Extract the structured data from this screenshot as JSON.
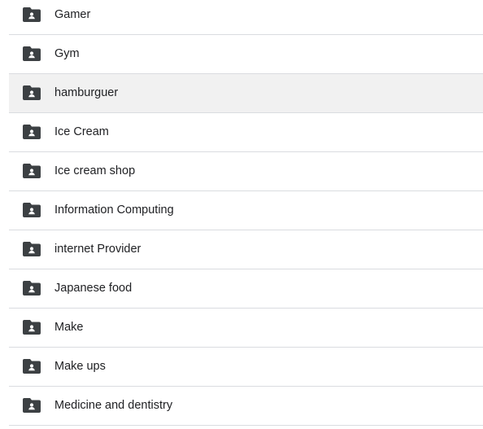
{
  "folders": [
    {
      "name": "Gamer",
      "icon": "shared-folder-icon",
      "selected": false
    },
    {
      "name": "Gym",
      "icon": "shared-folder-icon",
      "selected": false
    },
    {
      "name": "hamburguer",
      "icon": "shared-folder-icon",
      "selected": true
    },
    {
      "name": "Ice Cream",
      "icon": "shared-folder-icon",
      "selected": false
    },
    {
      "name": "Ice cream shop",
      "icon": "shared-folder-icon",
      "selected": false
    },
    {
      "name": "Information Computing",
      "icon": "shared-folder-icon",
      "selected": false
    },
    {
      "name": "internet Provider",
      "icon": "shared-folder-icon",
      "selected": false
    },
    {
      "name": "Japanese food",
      "icon": "shared-folder-icon",
      "selected": false
    },
    {
      "name": "Make",
      "icon": "shared-folder-icon",
      "selected": false
    },
    {
      "name": "Make ups",
      "icon": "shared-folder-icon",
      "selected": false
    },
    {
      "name": "Medicine and dentistry",
      "icon": "shared-folder-icon",
      "selected": false
    }
  ],
  "colors": {
    "icon": "#3c4043",
    "text": "#202124",
    "divider": "#dadce0",
    "selected_row": "#f1f1f1"
  }
}
